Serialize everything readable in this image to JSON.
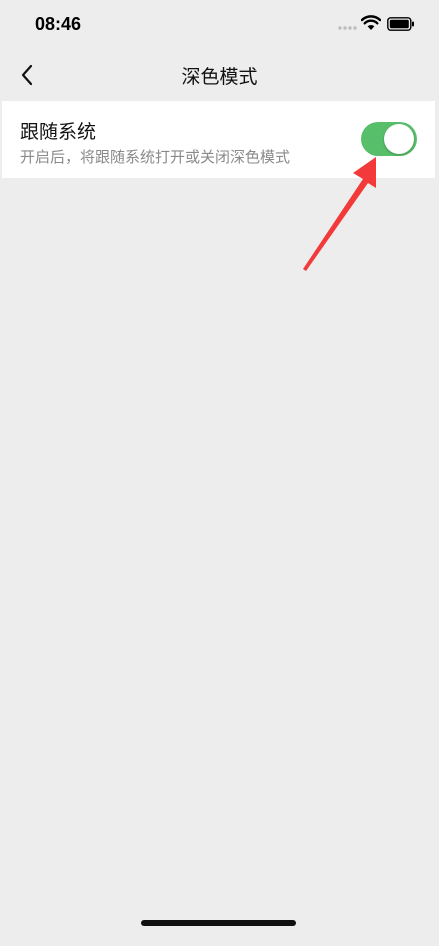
{
  "status_bar": {
    "time": "08:46"
  },
  "nav": {
    "title": "深色模式",
    "back_icon": "chevron-left-icon"
  },
  "setting": {
    "title": "跟随系统",
    "description": "开启后，将跟随系统打开或关闭深色模式",
    "toggle_on": true,
    "toggle_color": "#57be6a"
  },
  "annotation": {
    "arrow_color": "#f23a3a"
  },
  "colors": {
    "background": "#ededed",
    "card": "#ffffff"
  }
}
